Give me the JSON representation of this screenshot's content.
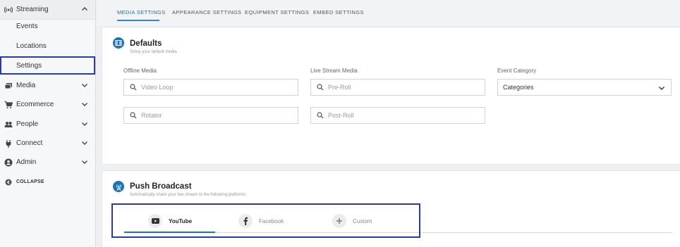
{
  "sidebar": {
    "streaming": "Streaming",
    "events": "Events",
    "locations": "Locations",
    "settings": "Settings",
    "media": "Media",
    "ecommerce": "Ecommerce",
    "people": "People",
    "connect": "Connect",
    "admin": "Admin",
    "collapse": "COLLAPSE"
  },
  "tabs": {
    "media_settings": "MEDIA SETTINGS",
    "appearance_settings": "APPEARANCE SETTINGS",
    "equipment_settings": "EQUIPMENT SETTINGS",
    "embed_settings": "EMBED SETTINGS"
  },
  "defaults": {
    "title": "Defaults",
    "subtitle": "Setup your default media",
    "offline_label": "Offline Media",
    "livestream_label": "Live Stream Media",
    "event_category_label": "Event Category",
    "video_loop_placeholder": "Video Loop",
    "rotator_placeholder": "Rotator",
    "preroll_placeholder": "Pre-Roll",
    "postroll_placeholder": "Post-Roll",
    "categories_value": "Categories"
  },
  "push": {
    "title": "Push Broadcast",
    "subtitle": "Automatically share your live stream to the following platforms",
    "tab_youtube": "YouTube",
    "tab_facebook": "Facebook",
    "tab_custom": "Custom"
  },
  "colors": {
    "accent": "#1c74b8",
    "selection_outline": "#2c3aa8"
  }
}
